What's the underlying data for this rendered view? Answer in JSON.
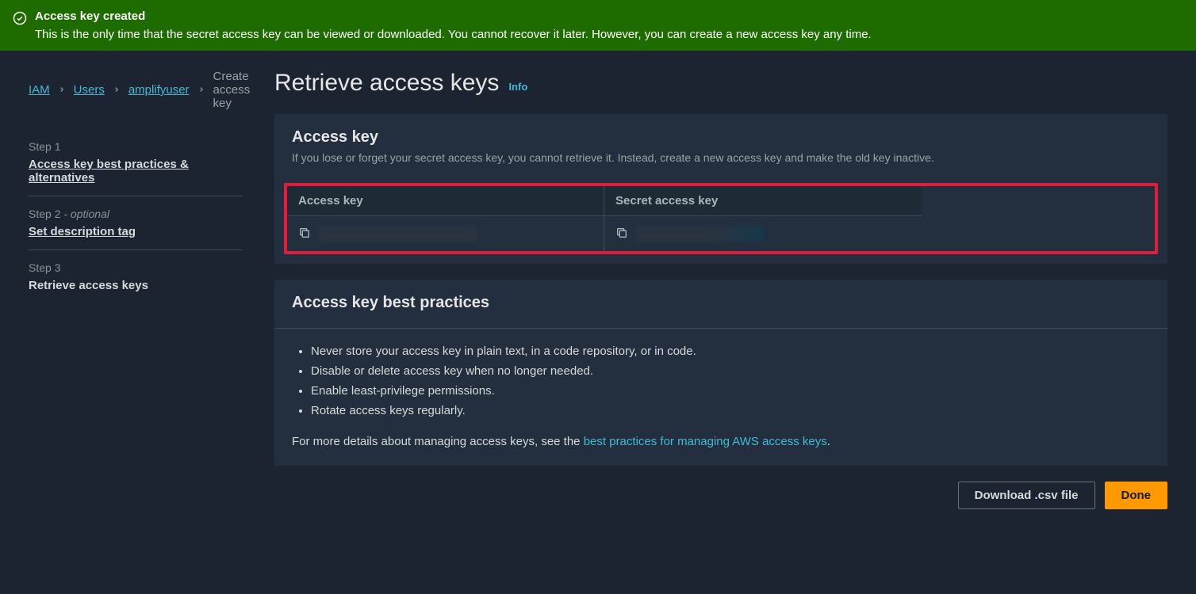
{
  "banner": {
    "title": "Access key created",
    "desc": "This is the only time that the secret access key can be viewed or downloaded. You cannot recover it later. However, you can create a new access key any time."
  },
  "breadcrumb": {
    "items": [
      "IAM",
      "Users",
      "amplifyuser"
    ],
    "current": "Create access key"
  },
  "steps": [
    {
      "num": "Step 1",
      "optional": "",
      "title": "Access key best practices & alternatives",
      "link": true
    },
    {
      "num": "Step 2",
      "optional": " - optional",
      "title": "Set description tag",
      "link": true
    },
    {
      "num": "Step 3",
      "optional": "",
      "title": "Retrieve access keys",
      "link": false
    }
  ],
  "page": {
    "title": "Retrieve access keys",
    "info": "Info"
  },
  "access_key_panel": {
    "title": "Access key",
    "sub": "If you lose or forget your secret access key, you cannot retrieve it. Instead, create a new access key and make the old key inactive.",
    "col1": "Access key",
    "col2": "Secret access key"
  },
  "best_practices": {
    "title": "Access key best practices",
    "items": [
      "Never store your access key in plain text, in a code repository, or in code.",
      "Disable or delete access key when no longer needed.",
      "Enable least-privilege permissions.",
      "Rotate access keys regularly."
    ],
    "more_prefix": "For more details about managing access keys, see the ",
    "more_link": "best practices for managing AWS access keys",
    "more_suffix": "."
  },
  "actions": {
    "download": "Download .csv file",
    "done": "Done"
  }
}
